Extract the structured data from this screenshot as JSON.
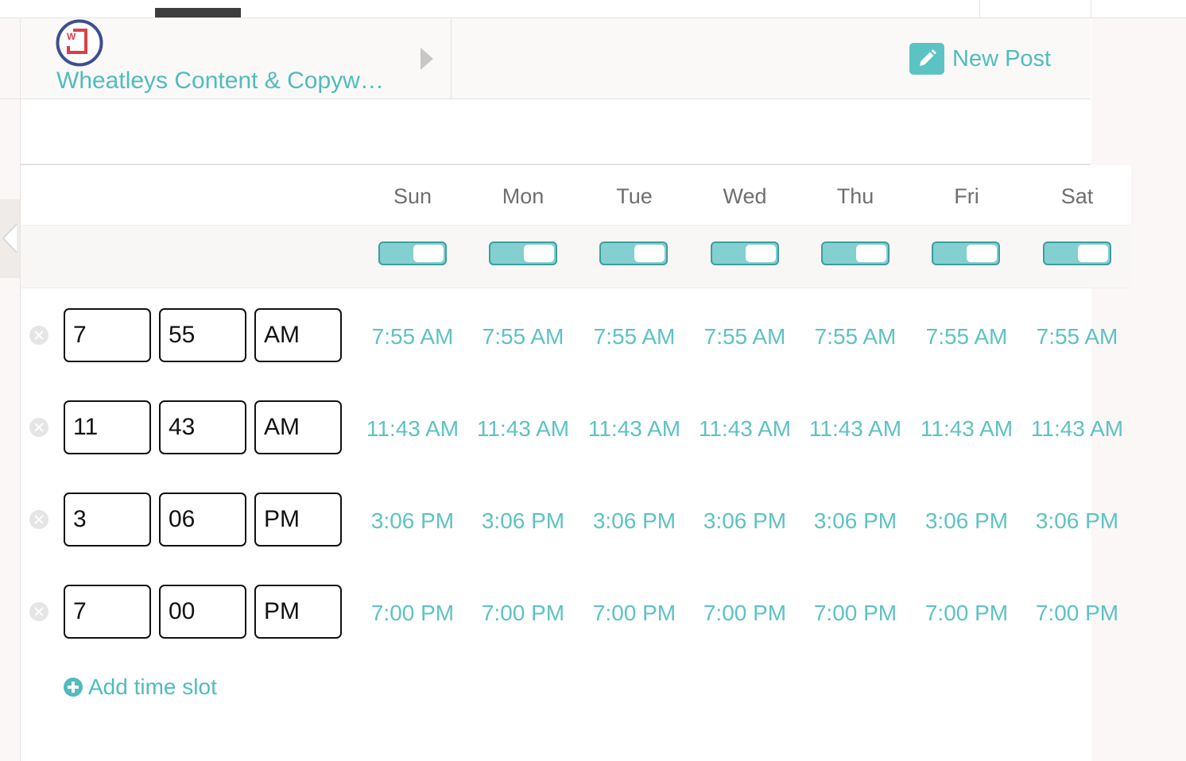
{
  "account": {
    "name": "Wheatleys Content & Copywriting",
    "logo_letter": "W",
    "logo_colors": {
      "ring": "#3d4f8f",
      "accent": "#d9404a"
    }
  },
  "header": {
    "new_post_label": "New Post"
  },
  "days": [
    "Sun",
    "Mon",
    "Tue",
    "Wed",
    "Thu",
    "Fri",
    "Sat"
  ],
  "day_toggles": [
    true,
    true,
    true,
    true,
    true,
    true,
    true
  ],
  "time_slots": [
    {
      "hour": "7",
      "minute": "55",
      "period": "AM",
      "display": "7:55 AM"
    },
    {
      "hour": "11",
      "minute": "43",
      "period": "AM",
      "display": "11:43 AM"
    },
    {
      "hour": "3",
      "minute": "06",
      "period": "PM",
      "display": "3:06 PM"
    },
    {
      "hour": "7",
      "minute": "00",
      "period": "PM",
      "display": "7:00 PM"
    }
  ],
  "add_slot_label": "Add time slot",
  "colors": {
    "accent": "#4fbcbd",
    "toggle_fill": "#84cfd0",
    "toggle_border": "#3d9e9f"
  }
}
